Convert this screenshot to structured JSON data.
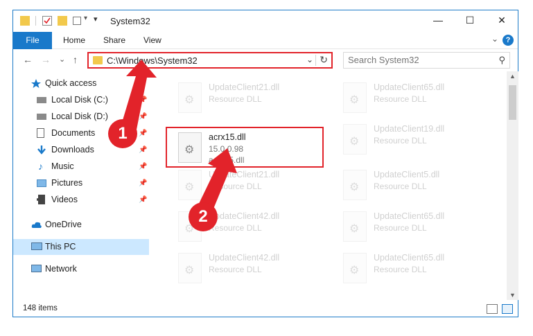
{
  "window": {
    "title": "System32",
    "minimize_glyph": "—",
    "maximize_glyph": "☐",
    "close_glyph": "✕"
  },
  "ribbon": {
    "tabs": [
      "File",
      "Home",
      "Share",
      "View"
    ],
    "help_glyph": "?",
    "collapse_glyph": "⌄"
  },
  "nav": {
    "back_glyph": "←",
    "forward_glyph": "→",
    "recent_glyph": "⌄",
    "up_glyph": "↑",
    "address": "C:\\Windows\\System32",
    "address_dropdown_glyph": "⌄",
    "refresh_glyph": "↻",
    "search_placeholder": "Search System32",
    "search_glyph": "⚲"
  },
  "sidebar": {
    "items": [
      {
        "label": "Quick access",
        "icon": "star-icon",
        "pinned": false
      },
      {
        "label": "Local Disk (C:)",
        "icon": "drive-icon",
        "pinned": true
      },
      {
        "label": "Local Disk (D:)",
        "icon": "drive-icon",
        "pinned": true
      },
      {
        "label": "Documents",
        "icon": "documents-icon",
        "pinned": true
      },
      {
        "label": "Downloads",
        "icon": "downloads-icon",
        "pinned": true
      },
      {
        "label": "Music",
        "icon": "music-icon",
        "pinned": true
      },
      {
        "label": "Pictures",
        "icon": "pictures-icon",
        "pinned": true
      },
      {
        "label": "Videos",
        "icon": "videos-icon",
        "pinned": true
      },
      {
        "label": "OneDrive",
        "icon": "cloud-icon",
        "pinned": false
      },
      {
        "label": "This PC",
        "icon": "computer-icon",
        "pinned": false,
        "selected": true
      },
      {
        "label": "Network",
        "icon": "network-icon",
        "pinned": false
      }
    ],
    "pin_glyph": "📌"
  },
  "files": [
    {
      "name": "UpdateClient21.dll",
      "type": "Resource DLL"
    },
    {
      "name": "UpdateClient65.dll",
      "type": "Resource DLL"
    },
    {
      "name": "acrx15.dll",
      "type": "15.0.0.98",
      "extra": "acrx15.dll",
      "highlighted": true
    },
    {
      "name": "UpdateClient19.dll",
      "type": "Resource DLL"
    },
    {
      "name": "UpdateClient21.dll",
      "type": "Resource DLL"
    },
    {
      "name": "UpdateClient5.dll",
      "type": "Resource DLL"
    },
    {
      "name": "UpdateClient42.dll",
      "type": "Resource DLL"
    },
    {
      "name": "UpdateClient65.dll",
      "type": "Resource DLL"
    },
    {
      "name": "UpdateClient42.dll",
      "type": "Resource DLL"
    },
    {
      "name": "UpdateClient65.dll",
      "type": "Resource DLL"
    }
  ],
  "status": {
    "item_count": "148 items"
  },
  "annotations": {
    "step1": "1",
    "step2": "2"
  },
  "colors": {
    "accent": "#1979ca",
    "highlight_red": "#e2232a",
    "selected_bg": "#cce8ff"
  }
}
